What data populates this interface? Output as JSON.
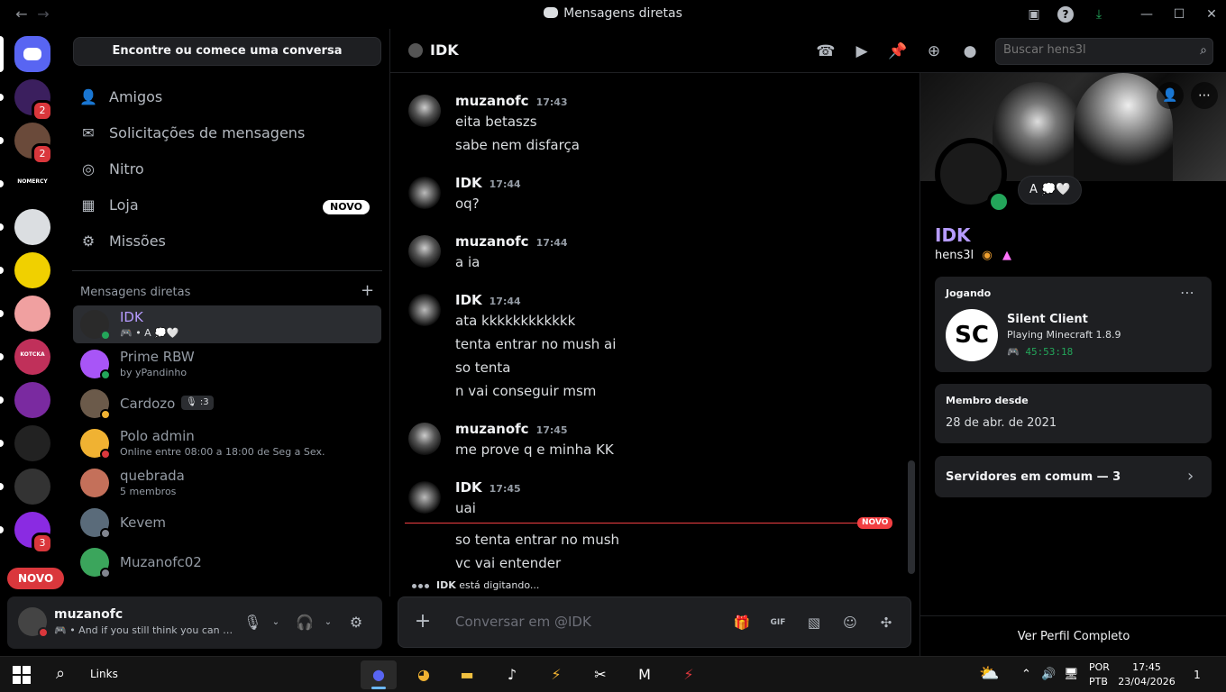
{
  "window": {
    "title": "Mensagens diretas"
  },
  "dm_sidebar": {
    "search_label": "Encontre ou comece uma conversa",
    "nav": [
      {
        "label": "Amigos",
        "icon": "friends-icon"
      },
      {
        "label": "Solicitações de mensagens",
        "icon": "envelope-icon"
      },
      {
        "label": "Nitro",
        "icon": "nitro-icon"
      },
      {
        "label": "Loja",
        "icon": "shop-icon",
        "badge": "NOVO"
      },
      {
        "label": "Missões",
        "icon": "quests-icon"
      }
    ],
    "section_title": "Mensagens diretas",
    "dms": [
      {
        "name": "IDK",
        "sub": "🎮 • A 💭🤍",
        "status": "online",
        "status_color": "#23a55a",
        "avatar_color": "#2a2a2a",
        "active": true
      },
      {
        "name": "Prime RBW",
        "sub": "by yPandinho",
        "status": "online",
        "status_color": "#23a55a",
        "avatar_color": "#a855f7"
      },
      {
        "name": "Cardozo",
        "sub": "",
        "tag": "🎙 :3",
        "status": "idle",
        "status_color": "#f0b232",
        "avatar_color": "#6b5a4a"
      },
      {
        "name": "Polo admin",
        "sub": "Online entre 08:00 a 18:00 de Seg a Sex.",
        "status": "dnd",
        "status_color": "#da373c",
        "avatar_color": "#f0b232"
      },
      {
        "name": "quebrada",
        "sub": "5 membros",
        "status": "",
        "status_color": "",
        "avatar_color": "#c4705a"
      },
      {
        "name": "Kevem",
        "sub": "",
        "status": "offline",
        "status_color": "#80848e",
        "avatar_color": "#5a6b7a"
      },
      {
        "name": "Muzanofc02",
        "sub": "",
        "status": "offline",
        "status_color": "#80848e",
        "avatar_color": "#3ba55c"
      }
    ],
    "novo_pill": "NOVO"
  },
  "user_panel": {
    "name": "muzanofc",
    "sub": "🎮 • And if you still think you can stay"
  },
  "chat": {
    "title": "IDK",
    "search_placeholder": "Buscar hens3l",
    "messages": [
      {
        "author": "muzanofc",
        "time": "17:43",
        "lines": [
          "eita betaszs",
          "sabe nem disfarça"
        ]
      },
      {
        "author": "IDK",
        "time": "17:44",
        "lines": [
          "oq?"
        ]
      },
      {
        "author": "muzanofc",
        "time": "17:44",
        "lines": [
          "a ia"
        ]
      },
      {
        "author": "IDK",
        "time": "17:44",
        "lines": [
          "ata kkkkkkkkkkkk",
          "tenta entrar no mush ai",
          "so tenta",
          "n vai conseguir msm"
        ]
      },
      {
        "author": "muzanofc",
        "time": "17:45",
        "lines": [
          "me prove q e minha KK"
        ]
      },
      {
        "author": "IDK",
        "time": "17:45",
        "lines": [
          "uai"
        ]
      }
    ],
    "new_tag": "NOVO",
    "after_new": [
      "so tenta entrar no mush",
      "vc vai entender"
    ],
    "typing": {
      "user": "IDK",
      "text": " está digitando..."
    },
    "composer_placeholder": "Conversar em @IDK"
  },
  "profile": {
    "display_name": "IDK",
    "username": "hens3l",
    "status_bubble": "A 💭🤍",
    "activity": {
      "title": "Jogando",
      "game": "Silent Client",
      "detail": "Playing Minecraft 1.8.9",
      "timer": "🎮 45:53:18",
      "logo": "SC"
    },
    "member_since": {
      "title": "Membro desde",
      "date": "28 de abr. de 2021"
    },
    "mutual": "Servidores em comum — 3",
    "full_profile": "Ver Perfil Completo"
  },
  "taskbar": {
    "search_label": "Links",
    "lang1": "POR",
    "lang2": "PTB",
    "time": "17:45",
    "date": "23/04/2026",
    "notifications": "1"
  },
  "servers": [
    {
      "color": "#5865f2",
      "label": ""
    },
    {
      "color": "#3b1f5e",
      "label": "",
      "badge": "2"
    },
    {
      "color": "#6a4a3a",
      "label": "",
      "badge": "2"
    },
    {
      "color": "#000000",
      "label": "NOMERCY"
    },
    {
      "color": "#dbdee1",
      "label": ""
    },
    {
      "color": "#f0d000",
      "label": ""
    },
    {
      "color": "#f0a0a0",
      "label": ""
    },
    {
      "color": "#c0305a",
      "label": "KOTCKA"
    },
    {
      "color": "#7a2aa0",
      "label": ""
    },
    {
      "color": "#222222",
      "label": ""
    },
    {
      "color": "#333333",
      "label": ""
    },
    {
      "color": "#8a2be2",
      "label": "",
      "badge": "3"
    }
  ]
}
